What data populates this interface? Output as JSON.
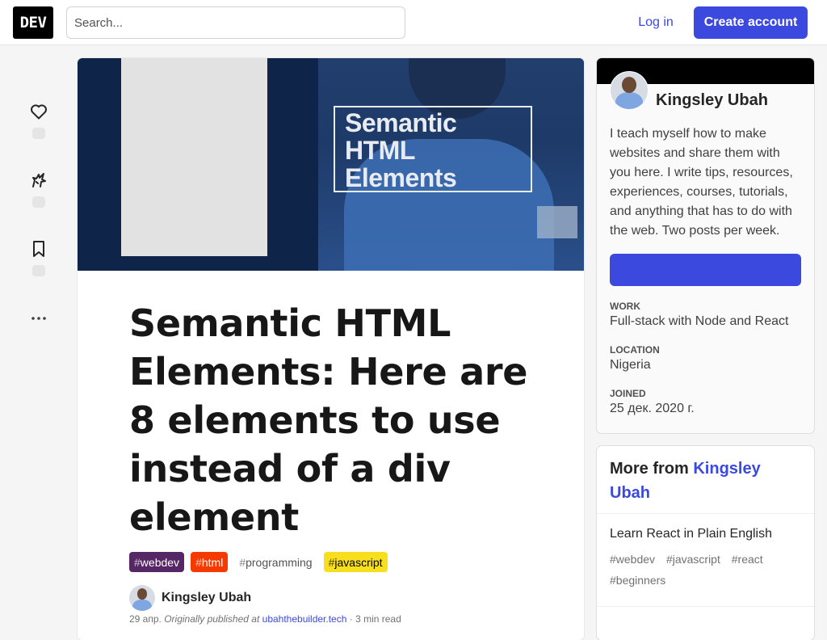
{
  "header": {
    "logo": "DEV",
    "search_placeholder": "Search...",
    "login": "Log in",
    "create_account": "Create account"
  },
  "cover": {
    "title": "Semantic HTML Elements"
  },
  "article": {
    "title": "Semantic HTML Elements: Here are 8 elements to use instead of a div element",
    "tags": [
      {
        "hash": "#",
        "name": "webdev"
      },
      {
        "hash": "#",
        "name": "html"
      },
      {
        "hash": "#",
        "name": "programming"
      },
      {
        "hash": "#",
        "name": "javascript"
      }
    ],
    "author": "Kingsley Ubah",
    "date": "29 апр.",
    "originally_published": "Originally published at",
    "source": "ubahthebuilder.tech",
    "read_time": "· 3 min read"
  },
  "sidebar": {
    "author_name": "Kingsley Ubah",
    "bio": "I teach myself how to make websites and share them with you here. I write tips, resources, experiences, courses, tutorials, and anything that has to do with the web. Two posts per week.",
    "work_label": "WORK",
    "work_value": "Full-stack with Node and React",
    "location_label": "LOCATION",
    "location_value": "Nigeria",
    "joined_label": "JOINED",
    "joined_value": "25 дек. 2020 г."
  },
  "more_from": {
    "prefix": "More from",
    "author": "Kingsley Ubah",
    "post_title": "Learn React in Plain English",
    "post_tags": [
      "#webdev",
      "#javascript",
      "#react",
      "#beginners"
    ]
  },
  "colors": {
    "brand": "#3b49df",
    "webdev": "#562765",
    "html": "#f53900",
    "javascript": "#f7df1e"
  }
}
